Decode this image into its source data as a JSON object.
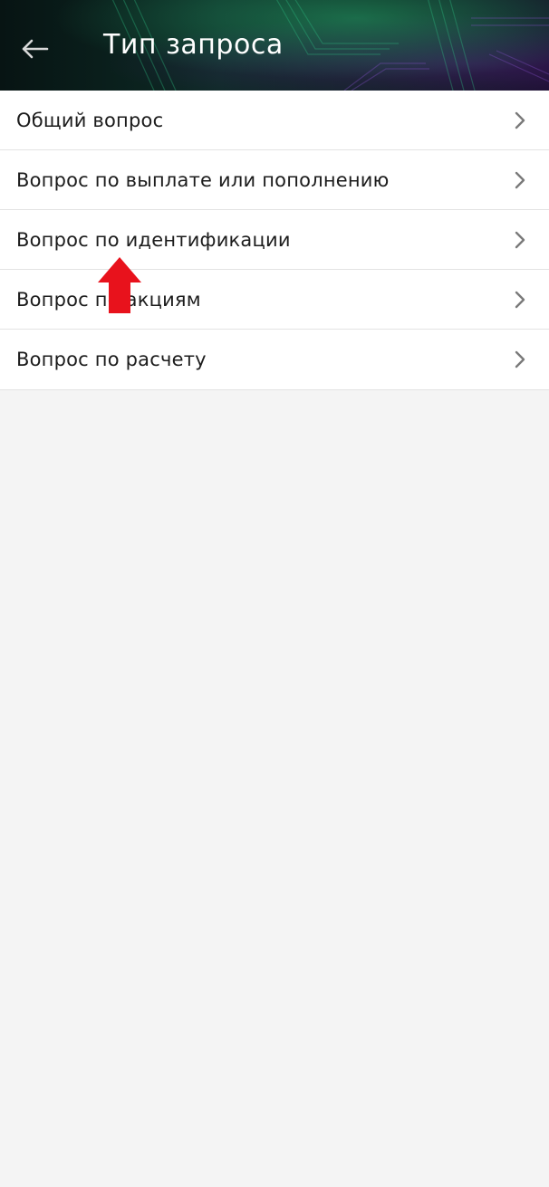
{
  "header": {
    "title": "Тип запроса",
    "back_icon": "arrow-left-icon",
    "colors": {
      "background_dark": "#071413",
      "accent_green": "#28aa6e",
      "accent_purple": "#5a288c"
    }
  },
  "menu": {
    "items": [
      {
        "label": "Общий вопрос",
        "icon": "chevron-right-icon"
      },
      {
        "label": "Вопрос по выплате или пополнению",
        "icon": "chevron-right-icon"
      },
      {
        "label": "Вопрос по идентификации",
        "icon": "chevron-right-icon"
      },
      {
        "label": "Вопрос по акциям",
        "icon": "chevron-right-icon"
      },
      {
        "label": "Вопрос по расчету",
        "icon": "chevron-right-icon"
      }
    ]
  },
  "annotation": {
    "icon": "red-up-arrow-icon",
    "color": "#e8121c"
  },
  "colors": {
    "page_background": "#f4f4f4",
    "list_background": "#ffffff",
    "divider": "#e3e3e3",
    "chevron": "#7a7a7a",
    "text": "#1c1c1c"
  }
}
